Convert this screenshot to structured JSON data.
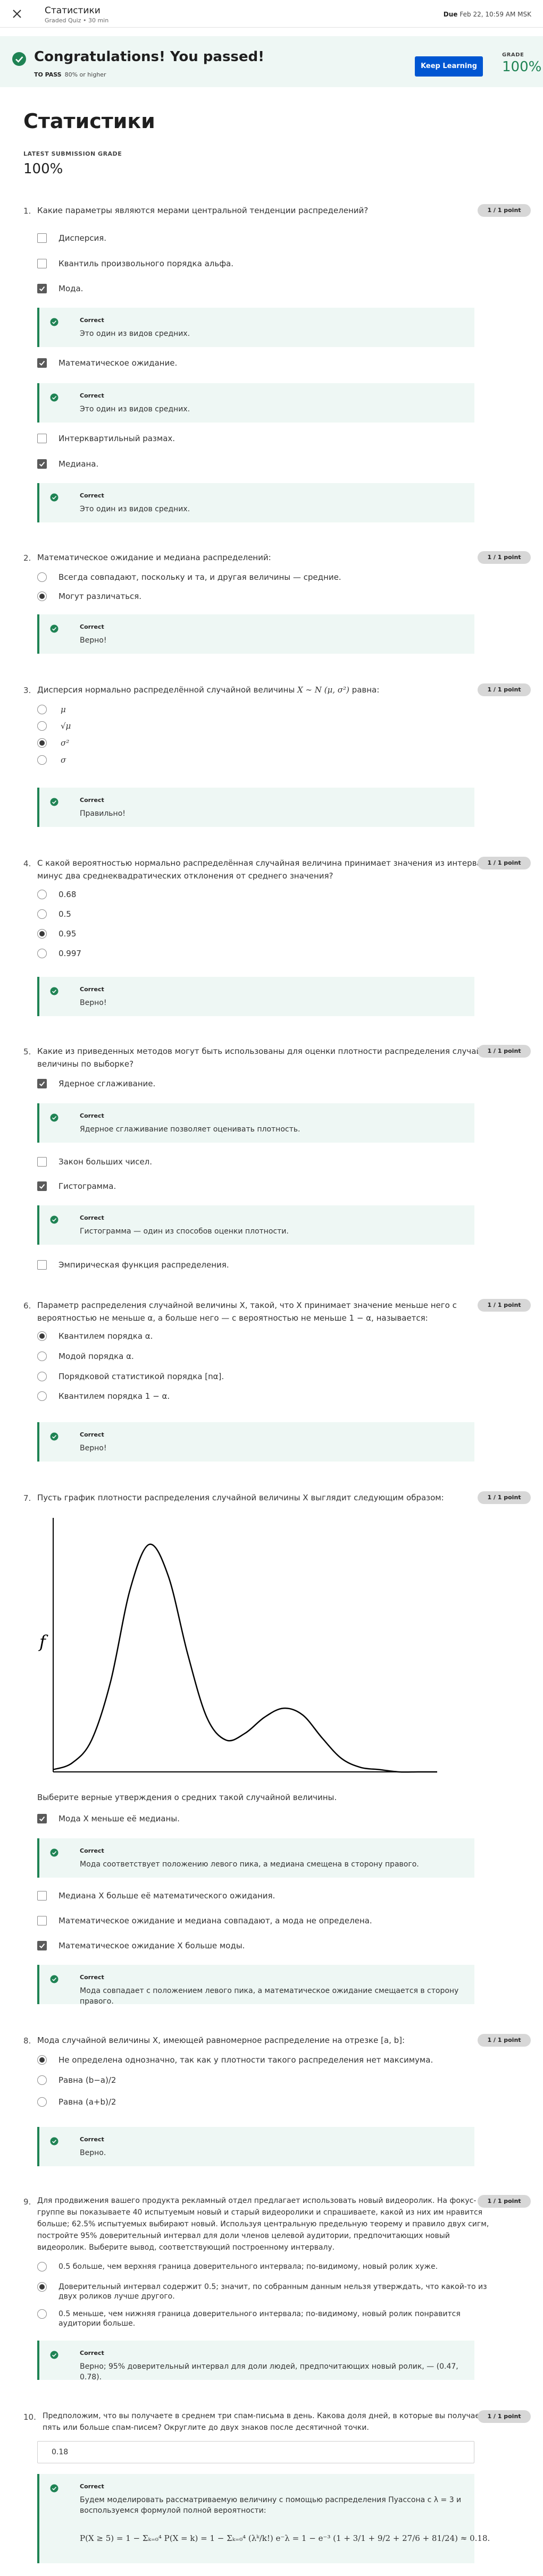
{
  "header": {
    "title": "Статистики",
    "subtitle": "Graded Quiz • 30 min",
    "due_label": "Due",
    "due_value": "Feb 22, 10:59 AM MSK"
  },
  "banner": {
    "heading": "Congratulations! You passed!",
    "to_pass_label": "TO PASS",
    "to_pass_value": "80% or higher",
    "keep_learning": "Keep Learning",
    "grade_label": "GRADE",
    "grade_value": "100%"
  },
  "page": {
    "title": "Статистики",
    "latest_label": "LATEST SUBMISSION GRADE",
    "latest_value": "100%"
  },
  "point_label": "1 / 1 point",
  "correct_label": "Correct",
  "questions": [
    {
      "num": "1.",
      "text": "Какие параметры являются мерами центральной тенденции распределений?",
      "options": [
        "Дисперсия.",
        "Квантиль произвольного порядка альфа.",
        "Мода.",
        "Математическое ожидание.",
        "Интерквартильный размах.",
        "Медиана."
      ],
      "feedback": [
        "Это один из видов средних.",
        "Это один из видов средних.",
        "Это один из видов средних."
      ]
    },
    {
      "num": "2.",
      "text": "Математическое ожидание и медиана распределений:",
      "options": [
        "Всегда совпадают, поскольку и та, и другая величины — средние.",
        "Могут различаться."
      ],
      "feedback": [
        "Верно!"
      ]
    },
    {
      "num": "3.",
      "text": "Дисперсия нормально распределённой случайной величины",
      "text_math": "X ∼ N (μ, σ²)",
      "text_tail": "равна:",
      "options": [
        "μ",
        "√μ",
        "σ²",
        "σ"
      ],
      "feedback": [
        "Правильно!"
      ]
    },
    {
      "num": "4.",
      "text_lines": [
        "С какой вероятностью нормально распределённая случайная величина принимает значения из интервала плюс-",
        "минус два среднеквадратических отклонения от среднего значения?"
      ],
      "options": [
        "0.68",
        "0.5",
        "0.95",
        "0.997"
      ],
      "feedback": [
        "Верно!"
      ]
    },
    {
      "num": "5.",
      "text_lines": [
        "Какие из приведенных методов могут быть использованы для оценки плотности распределения случайной",
        "величины по выборке?"
      ],
      "options": [
        "Ядерное сглаживание.",
        "Закон больших чисел.",
        "Гистограмма.",
        "Эмпирическая функция распределения."
      ],
      "feedback": [
        "Ядерное сглаживание позволяет оценивать плотность.",
        "Гистограмма — один из способов оценки плотности."
      ]
    },
    {
      "num": "6.",
      "text_lines": [
        "Параметр распределения случайной величины X, такой, что X принимает значение меньше него с",
        "вероятностью не меньше α, а больше него — с вероятностью не меньше 1 − α, называется:"
      ],
      "options": [
        "Квантилем порядка α.",
        "Модой порядка α.",
        "Порядковой статистикой порядка [nα].",
        "Квантилем порядка 1 − α."
      ],
      "feedback": [
        "Верно!"
      ]
    },
    {
      "num": "7.",
      "text": "Пусть график плотности распределения случайной величины X выглядит следующим образом:",
      "plot_label": "f",
      "prompt": "Выберите верные утверждения о средних такой случайной величины.",
      "options": [
        "Мода X меньше её медианы.",
        "Медиана X больше её математического ожидания.",
        "Математическое ожидание и медиана совпадают, а мода не определена.",
        "Математическое ожидание X больше моды."
      ],
      "feedback": [
        "Мода соответствует положению левого пика, а медиана смещена в сторону правого.",
        "Мода совпадает с положением левого пика, а математическое ожидание смещается в сторону правого."
      ]
    },
    {
      "num": "8.",
      "text": "Мода случайной величины X, имеющей равномерное распределение на отрезке [a, b]:",
      "options": [
        "Не определена однозначно, так как у плотности такого распределения нет максимума.",
        "Равна (b−a)/2",
        "Равна (a+b)/2"
      ],
      "feedback": [
        "Верно."
      ]
    },
    {
      "num": "9.",
      "text_lines": [
        "Для продвижения вашего продукта рекламный отдел предлагает использовать новый видеоролик. На фокус-",
        "группе вы показываете 40 испытуемым новый и старый видеоролики и спрашиваете, какой из них им нравится",
        "больше; 62.5% испытуемых выбирают новый. Используя центральную предельную теорему и правило двух сигм,",
        "постройте 95% доверительный интервал для доли членов целевой аудитории, предпочитающих новый",
        "видеоролик. Выберите вывод, соответствующий построенному интервалу."
      ],
      "options": [
        "0.5 больше, чем верхняя граница доверительного интервала; по-видимому, новый ролик хуже.",
        "Доверительный интервал содержит 0.5; значит, по собранным данным нельзя утверждать, что какой-то из",
        "0.5 меньше, чем нижняя граница доверительного интервала; по-видимому, новый ролик понравится"
      ],
      "option_tails": [
        "",
        "двух роликов лучше другого.",
        "аудитории больше."
      ],
      "feedback": [
        "Верно; 95% доверительный интервал для доли людей, предпочитающих новый ролик, — (0.47, 0.78)."
      ]
    },
    {
      "num": "10.",
      "text_lines": [
        "Предположим, что вы получаете в среднем три спам-письма в день. Какова доля дней, в которые вы получаете",
        "пять или больше спам-писем? Округлите до двух знаков после десятичной точки."
      ],
      "answer": "0.18",
      "feedback_lines": [
        "Будем моделировать рассматриваемую величину с помощью распределения Пуассона с λ = 3 и",
        "воспользуемся формулой полной вероятности:"
      ],
      "formula": "P(X ≥ 5) = 1 − Σₖ₌₀⁴ P(X = k) = 1 − Σₖ₌₀⁴ (λᵏ/k!) e⁻λ = 1 − e⁻³ (1 + 3/1 + 9/2 + 27/6 + 81/24) ≈ 0.18."
    }
  ],
  "chart_data": {
    "type": "line",
    "title": "",
    "xlabel": "",
    "ylabel": "f",
    "x": [
      0,
      0.5,
      1,
      1.5,
      2,
      2.5,
      3,
      3.5,
      4,
      4.5,
      5,
      5.5,
      6,
      6.5,
      7,
      7.5,
      8,
      8.5,
      9,
      9.5,
      10
    ],
    "series": [
      {
        "values": [
          0.01,
          0.04,
          0.14,
          0.4,
          0.8,
          1.0,
          0.86,
          0.52,
          0.24,
          0.14,
          0.17,
          0.24,
          0.28,
          0.25,
          0.15,
          0.06,
          0.02,
          0.01,
          0.0,
          0.0,
          0.0
        ]
      }
    ],
    "grid": false
  },
  "colors": {
    "accent": "#0056d2",
    "success": "#1f8354",
    "banner_bg": "#eef7f4",
    "pill_bg": "#d7d7d7"
  },
  "icons": {
    "close": "close-icon",
    "banner_check": "check-circle-icon",
    "feedback_check": "check-circle-icon",
    "checkbox": "checkmark-icon"
  }
}
